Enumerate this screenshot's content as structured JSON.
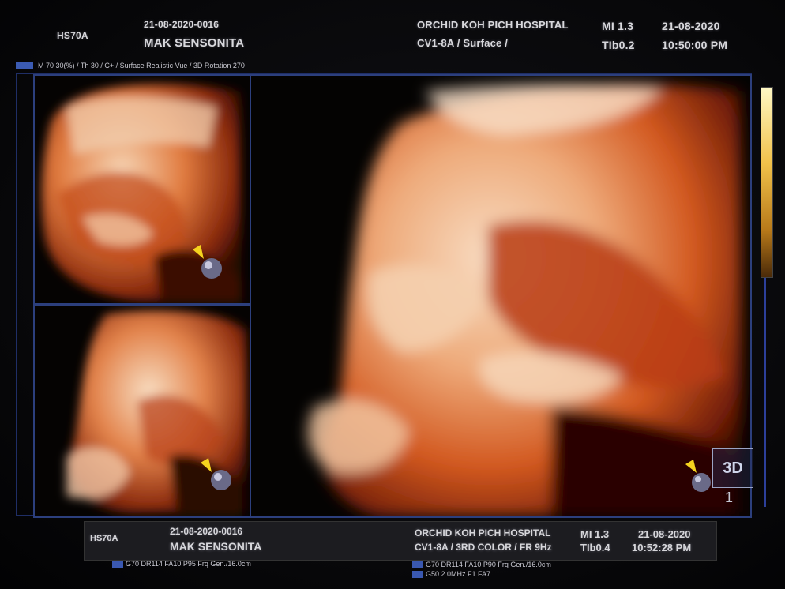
{
  "header": {
    "model": "HS70A",
    "patient_id": "21-08-2020-0016",
    "patient_name": "MAK SENSONITA",
    "hospital": "ORCHID KOH PICH HOSPITAL",
    "probe_mode": "CV1-8A / Surface /",
    "mi": "MI  1.3",
    "tib": "TIb0.2",
    "date": "21-08-2020",
    "time": "10:50:00 PM"
  },
  "params_line": "M 70 30(%) / Th 30 / C+ / Surface Realistic Vue / 3D Rotation 270",
  "view_cube_label": "3D",
  "view_index": "1",
  "footer": {
    "model": "HS70A",
    "patient_id": "21-08-2020-0016",
    "patient_name": "MAK SENSONITA",
    "hospital": "ORCHID KOH PICH HOSPITAL",
    "probe_mode": "CV1-8A / 3RD COLOR / FR 9Hz",
    "mi": "MI  1.3",
    "tib": "TIb0.4",
    "date": "21-08-2020",
    "time": "10:52:28 PM"
  },
  "bottom": {
    "line_left": "G70 DR114 FA10 P95 Frq Gen./16.0cm",
    "line_right_1": "G70 DR114 FA10 P90 Frq Gen./16.0cm",
    "line_right_2": "G50 2.0MHz F1 FA7"
  },
  "colors": {
    "tissue_light": "#f3c9a4",
    "tissue_mid": "#d9652a",
    "tissue_dark": "#6e1c08",
    "frame_blue": "#2c3f7d",
    "marker_arrow": "#f5d31e"
  }
}
